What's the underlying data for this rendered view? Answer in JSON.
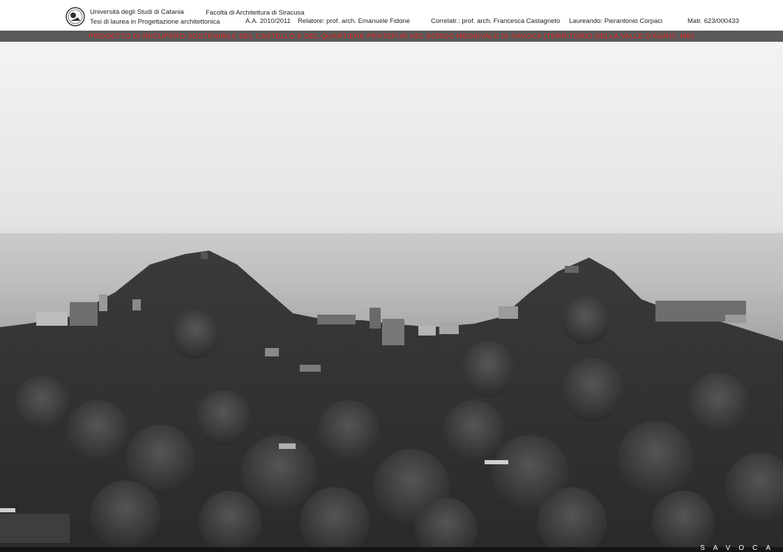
{
  "header": {
    "university": "Università degli Studi di Catania",
    "degree": "Tesi di laurea in Progettazione architettonica",
    "faculty": "Facoltà di Architettura di Siracusa",
    "academic_year": "A.A. 2010/2011",
    "relatore": "Relatore: prof. arch. Emanuele Fidone",
    "correlatore": "Correlatr.: prof. arch. Francesca Castagneto",
    "laureando": "Laureando: Pierantonio Corpaci",
    "matricola": "Matr. 623/000433"
  },
  "project_title": "PROGETTO DI RECUPERO SOSTENIBILE DEL CASTELLO E DEL QUARTIERE PENTEFUR NEL BORGO MEDIEVALE DI SAVOCA (TERRITORIO DELLA VALLE D'AGRO', ME)",
  "caption": "SAVOCA",
  "colors": {
    "title_red": "#e0221c",
    "band_gray": "#5a5a5a"
  }
}
